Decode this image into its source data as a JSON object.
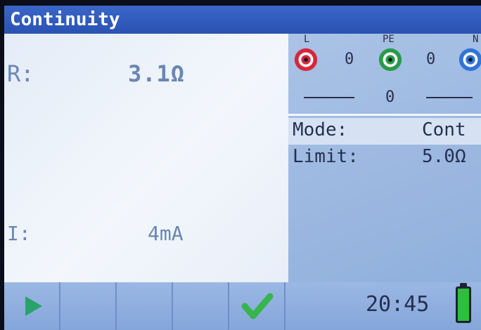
{
  "title": "Continuity",
  "result": {
    "r_label": "R:",
    "r_value": "3.1Ω",
    "i_label": "I:",
    "i_value": "4mA"
  },
  "terminals": {
    "l_label": "L",
    "pe_label": "PE",
    "n_label": "N",
    "l_pe_value": "0",
    "pe_n_value": "0",
    "l_n_value": "0"
  },
  "params": {
    "mode_label": "Mode:",
    "mode_value": "Cont",
    "limit_label": "Limit:",
    "limit_value": "5.0Ω"
  },
  "status": {
    "clock": "20:45",
    "battery_level": 1.0
  },
  "colors": {
    "title_bar": "#2a52b2",
    "l_terminal": "#d8263c",
    "pe_terminal": "#2a9a4a",
    "n_terminal": "#2f74d8",
    "check": "#35b54a",
    "play": "#2aa36b"
  },
  "softkeys": [
    {
      "icon": "play-icon"
    },
    {
      "icon": ""
    },
    {
      "icon": ""
    },
    {
      "icon": ""
    },
    {
      "icon": "check-icon"
    }
  ]
}
